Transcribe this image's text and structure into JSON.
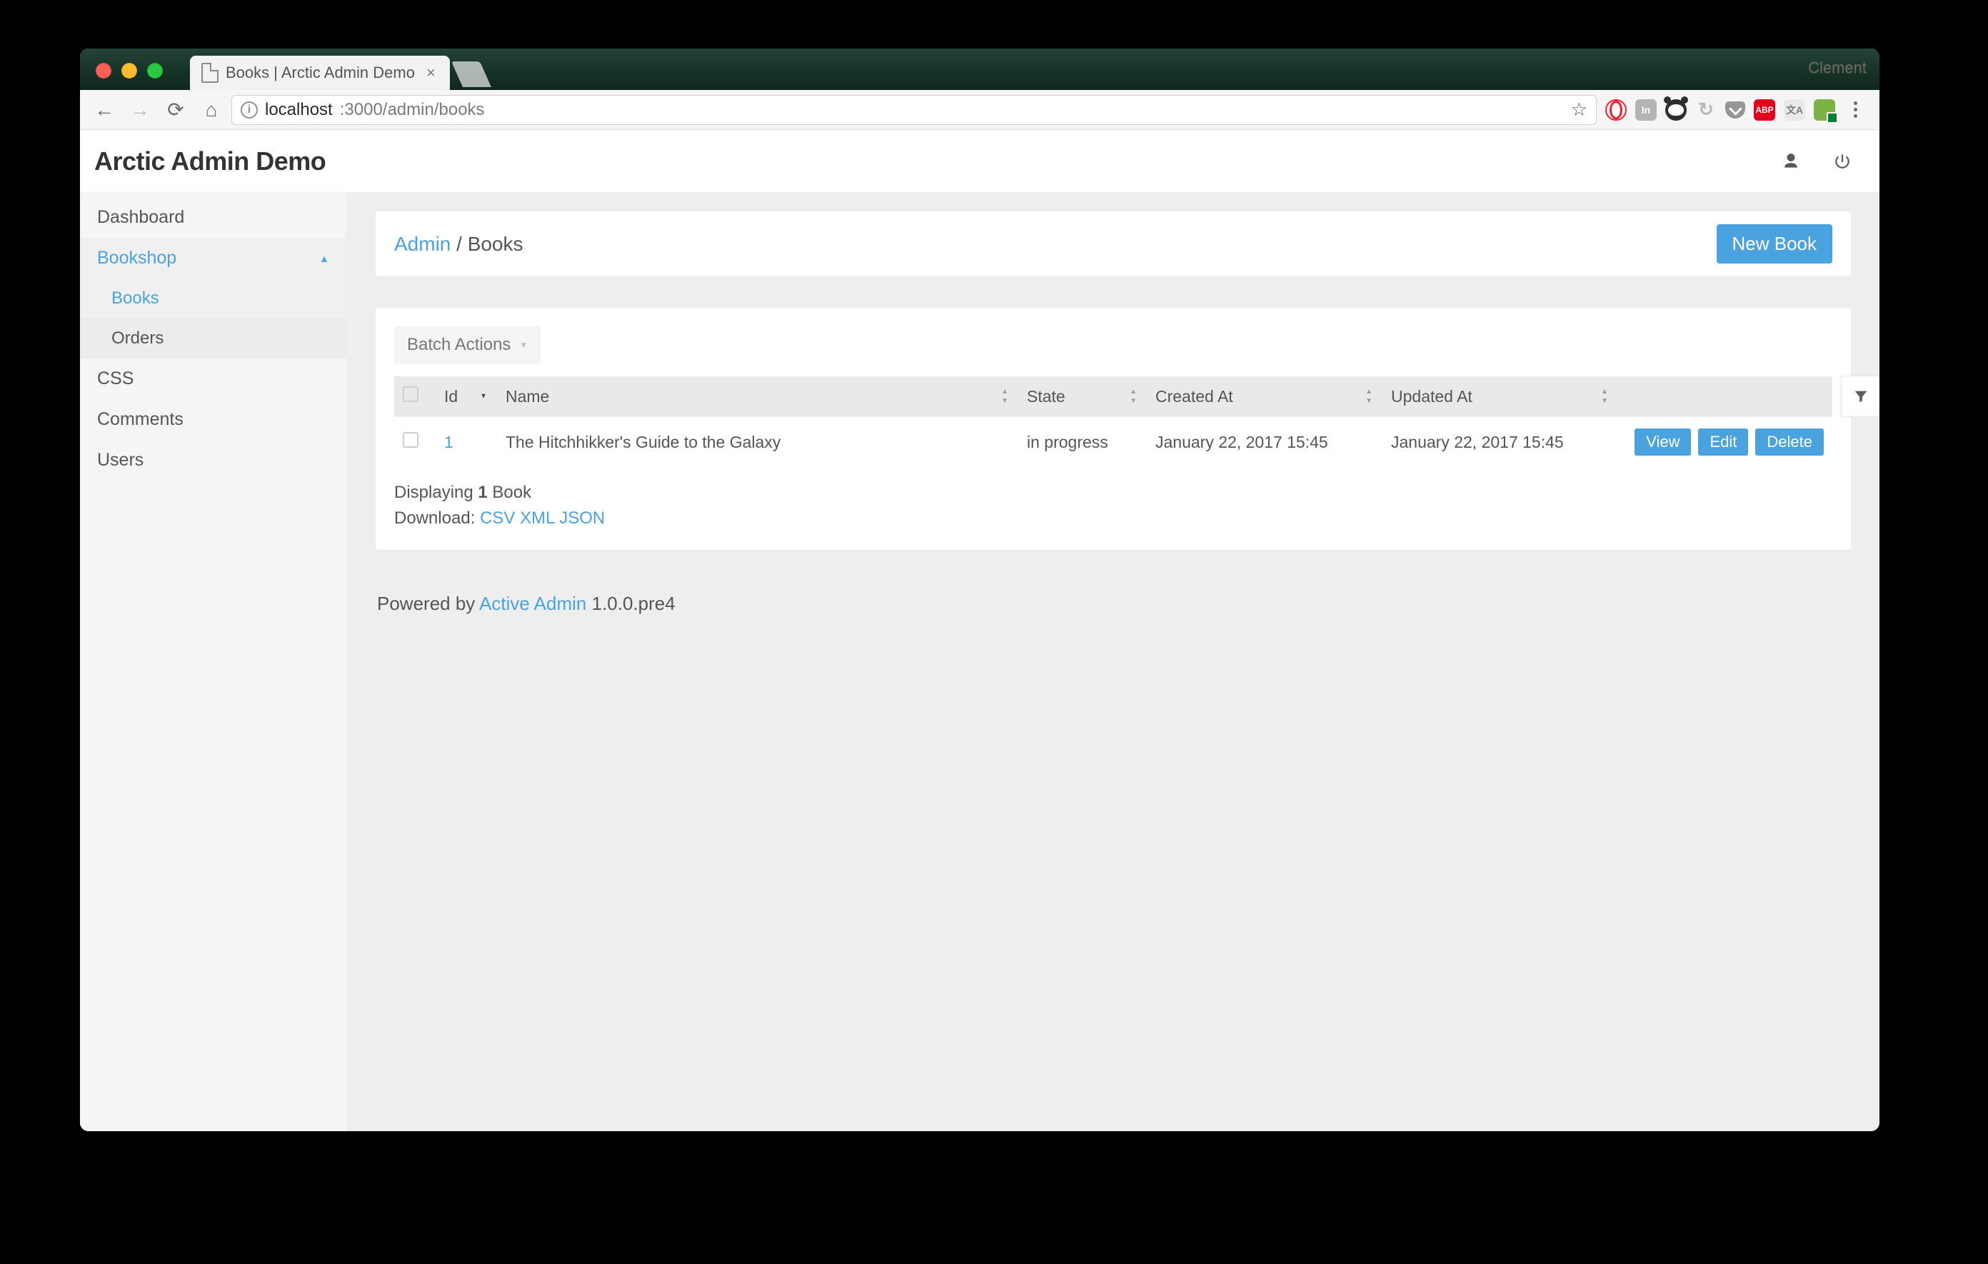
{
  "os_profile_name": "Clement",
  "browser": {
    "tab_title": "Books | Arctic Admin Demo",
    "url_host": "localhost",
    "url_port_path": ":3000/admin/books"
  },
  "header": {
    "title": "Arctic Admin Demo"
  },
  "sidebar": {
    "items": [
      {
        "label": "Dashboard"
      },
      {
        "label": "Bookshop",
        "expanded": true,
        "children": [
          {
            "label": "Books",
            "active": true
          },
          {
            "label": "Orders"
          }
        ]
      },
      {
        "label": "CSS"
      },
      {
        "label": "Comments"
      },
      {
        "label": "Users"
      }
    ]
  },
  "breadcrumbs": {
    "root": "Admin",
    "current": "Books"
  },
  "actions": {
    "new_label": "New Book",
    "batch_label": "Batch Actions"
  },
  "table": {
    "columns": [
      "Id",
      "Name",
      "State",
      "Created At",
      "Updated At"
    ],
    "rows": [
      {
        "id": "1",
        "name": "The Hitchhikker's Guide to the Galaxy",
        "state": "in progress",
        "created_at": "January 22, 2017 15:45",
        "updated_at": "January 22, 2017 15:45"
      }
    ],
    "row_actions": {
      "view": "View",
      "edit": "Edit",
      "delete": "Delete"
    }
  },
  "listing": {
    "displaying_prefix": "Displaying ",
    "displaying_count": "1",
    "displaying_suffix": " Book",
    "download_label": "Download: ",
    "download_csv": "CSV",
    "download_xml": "XML",
    "download_json": "JSON"
  },
  "footer": {
    "powered_prefix": "Powered by ",
    "powered_link": "Active Admin",
    "powered_version": " 1.0.0.pre4"
  },
  "ext_labels": {
    "in": "In",
    "abp": "ABP",
    "trans": "文A"
  }
}
